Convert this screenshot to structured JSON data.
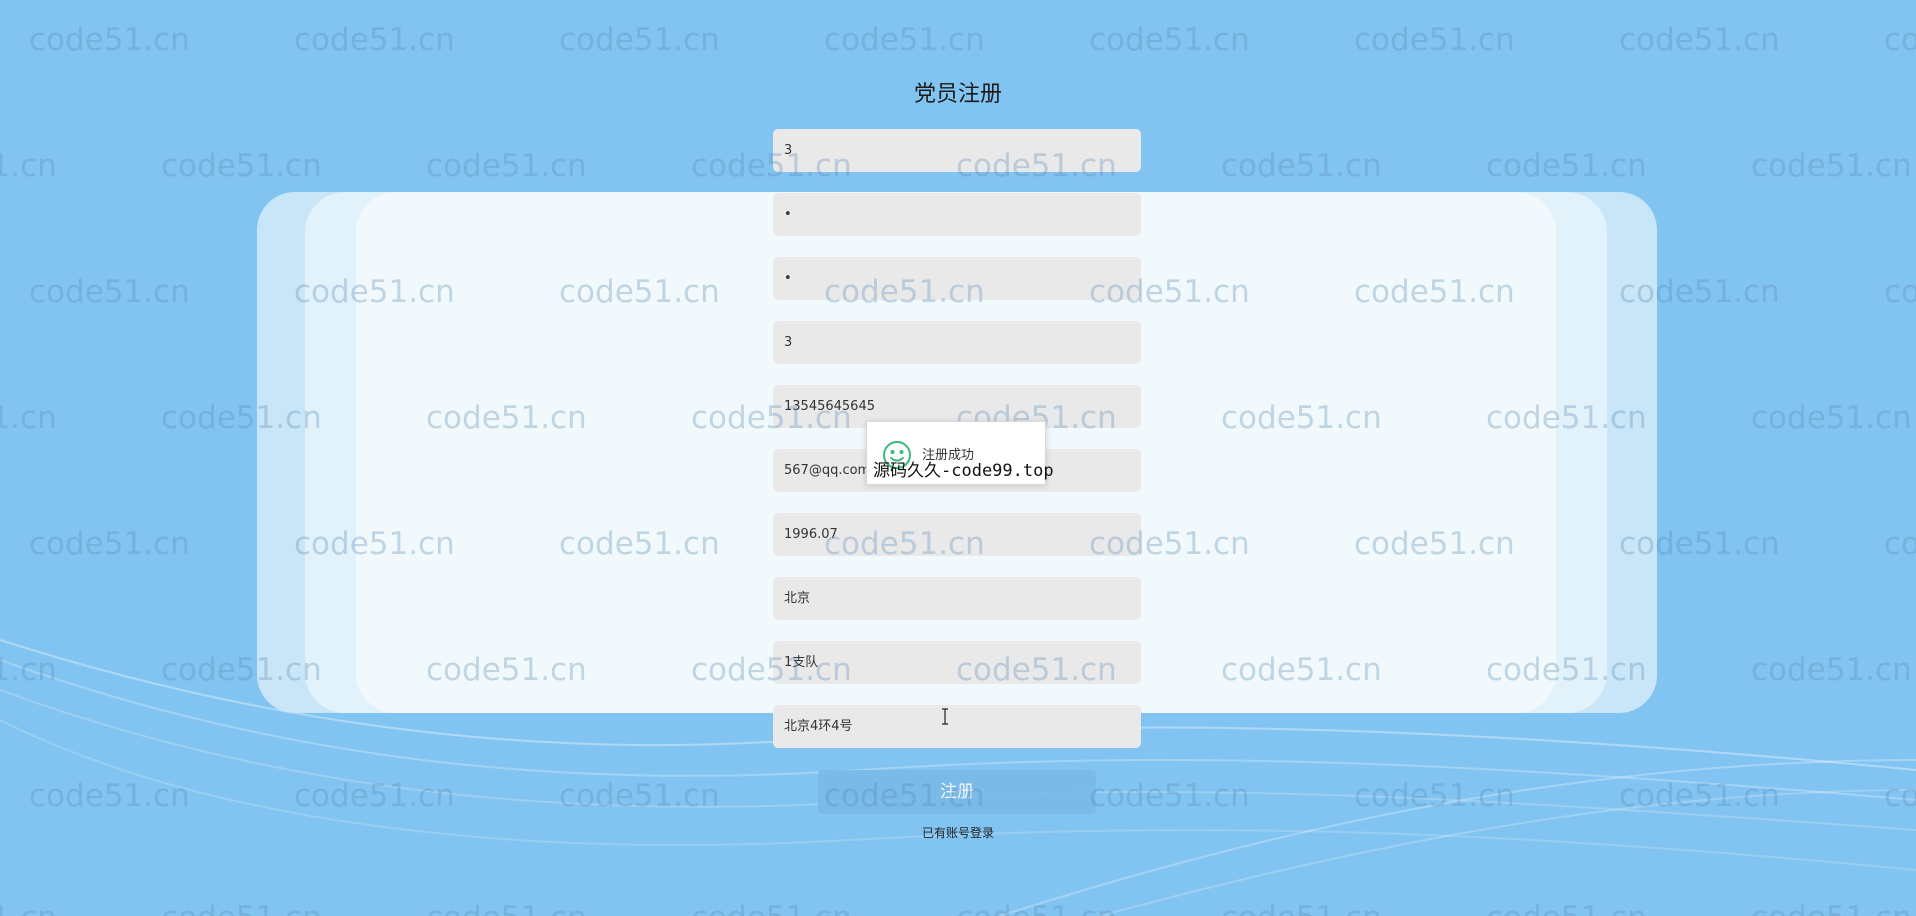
{
  "page": {
    "title": "党员注册"
  },
  "form": {
    "fields": [
      {
        "name": "account",
        "value": "3",
        "type": "text"
      },
      {
        "name": "password",
        "value": "•",
        "type": "password"
      },
      {
        "name": "confirm-password",
        "value": "•",
        "type": "password"
      },
      {
        "name": "name",
        "value": "3",
        "type": "text"
      },
      {
        "name": "phone",
        "value": "13545645645",
        "type": "text"
      },
      {
        "name": "email",
        "value": "567@qq.com",
        "type": "text"
      },
      {
        "name": "join-date",
        "value": "1996.07",
        "type": "text"
      },
      {
        "name": "region",
        "value": "北京",
        "type": "text"
      },
      {
        "name": "branch",
        "value": "1支队",
        "type": "text"
      },
      {
        "name": "address",
        "value": "北京4环4号",
        "type": "text"
      }
    ],
    "submit_label": "注册",
    "login_link": "已有账号登录"
  },
  "toast": {
    "message": "注册成功",
    "icon": "smile-icon",
    "overlay_watermark": "源码久久-code99.top"
  },
  "watermark_text": "code51.cn",
  "colors": {
    "background": "#82c4f1",
    "field_background": "#e9e9ea",
    "button_background": "#78b9e8",
    "toast_icon": "#3cb878"
  }
}
